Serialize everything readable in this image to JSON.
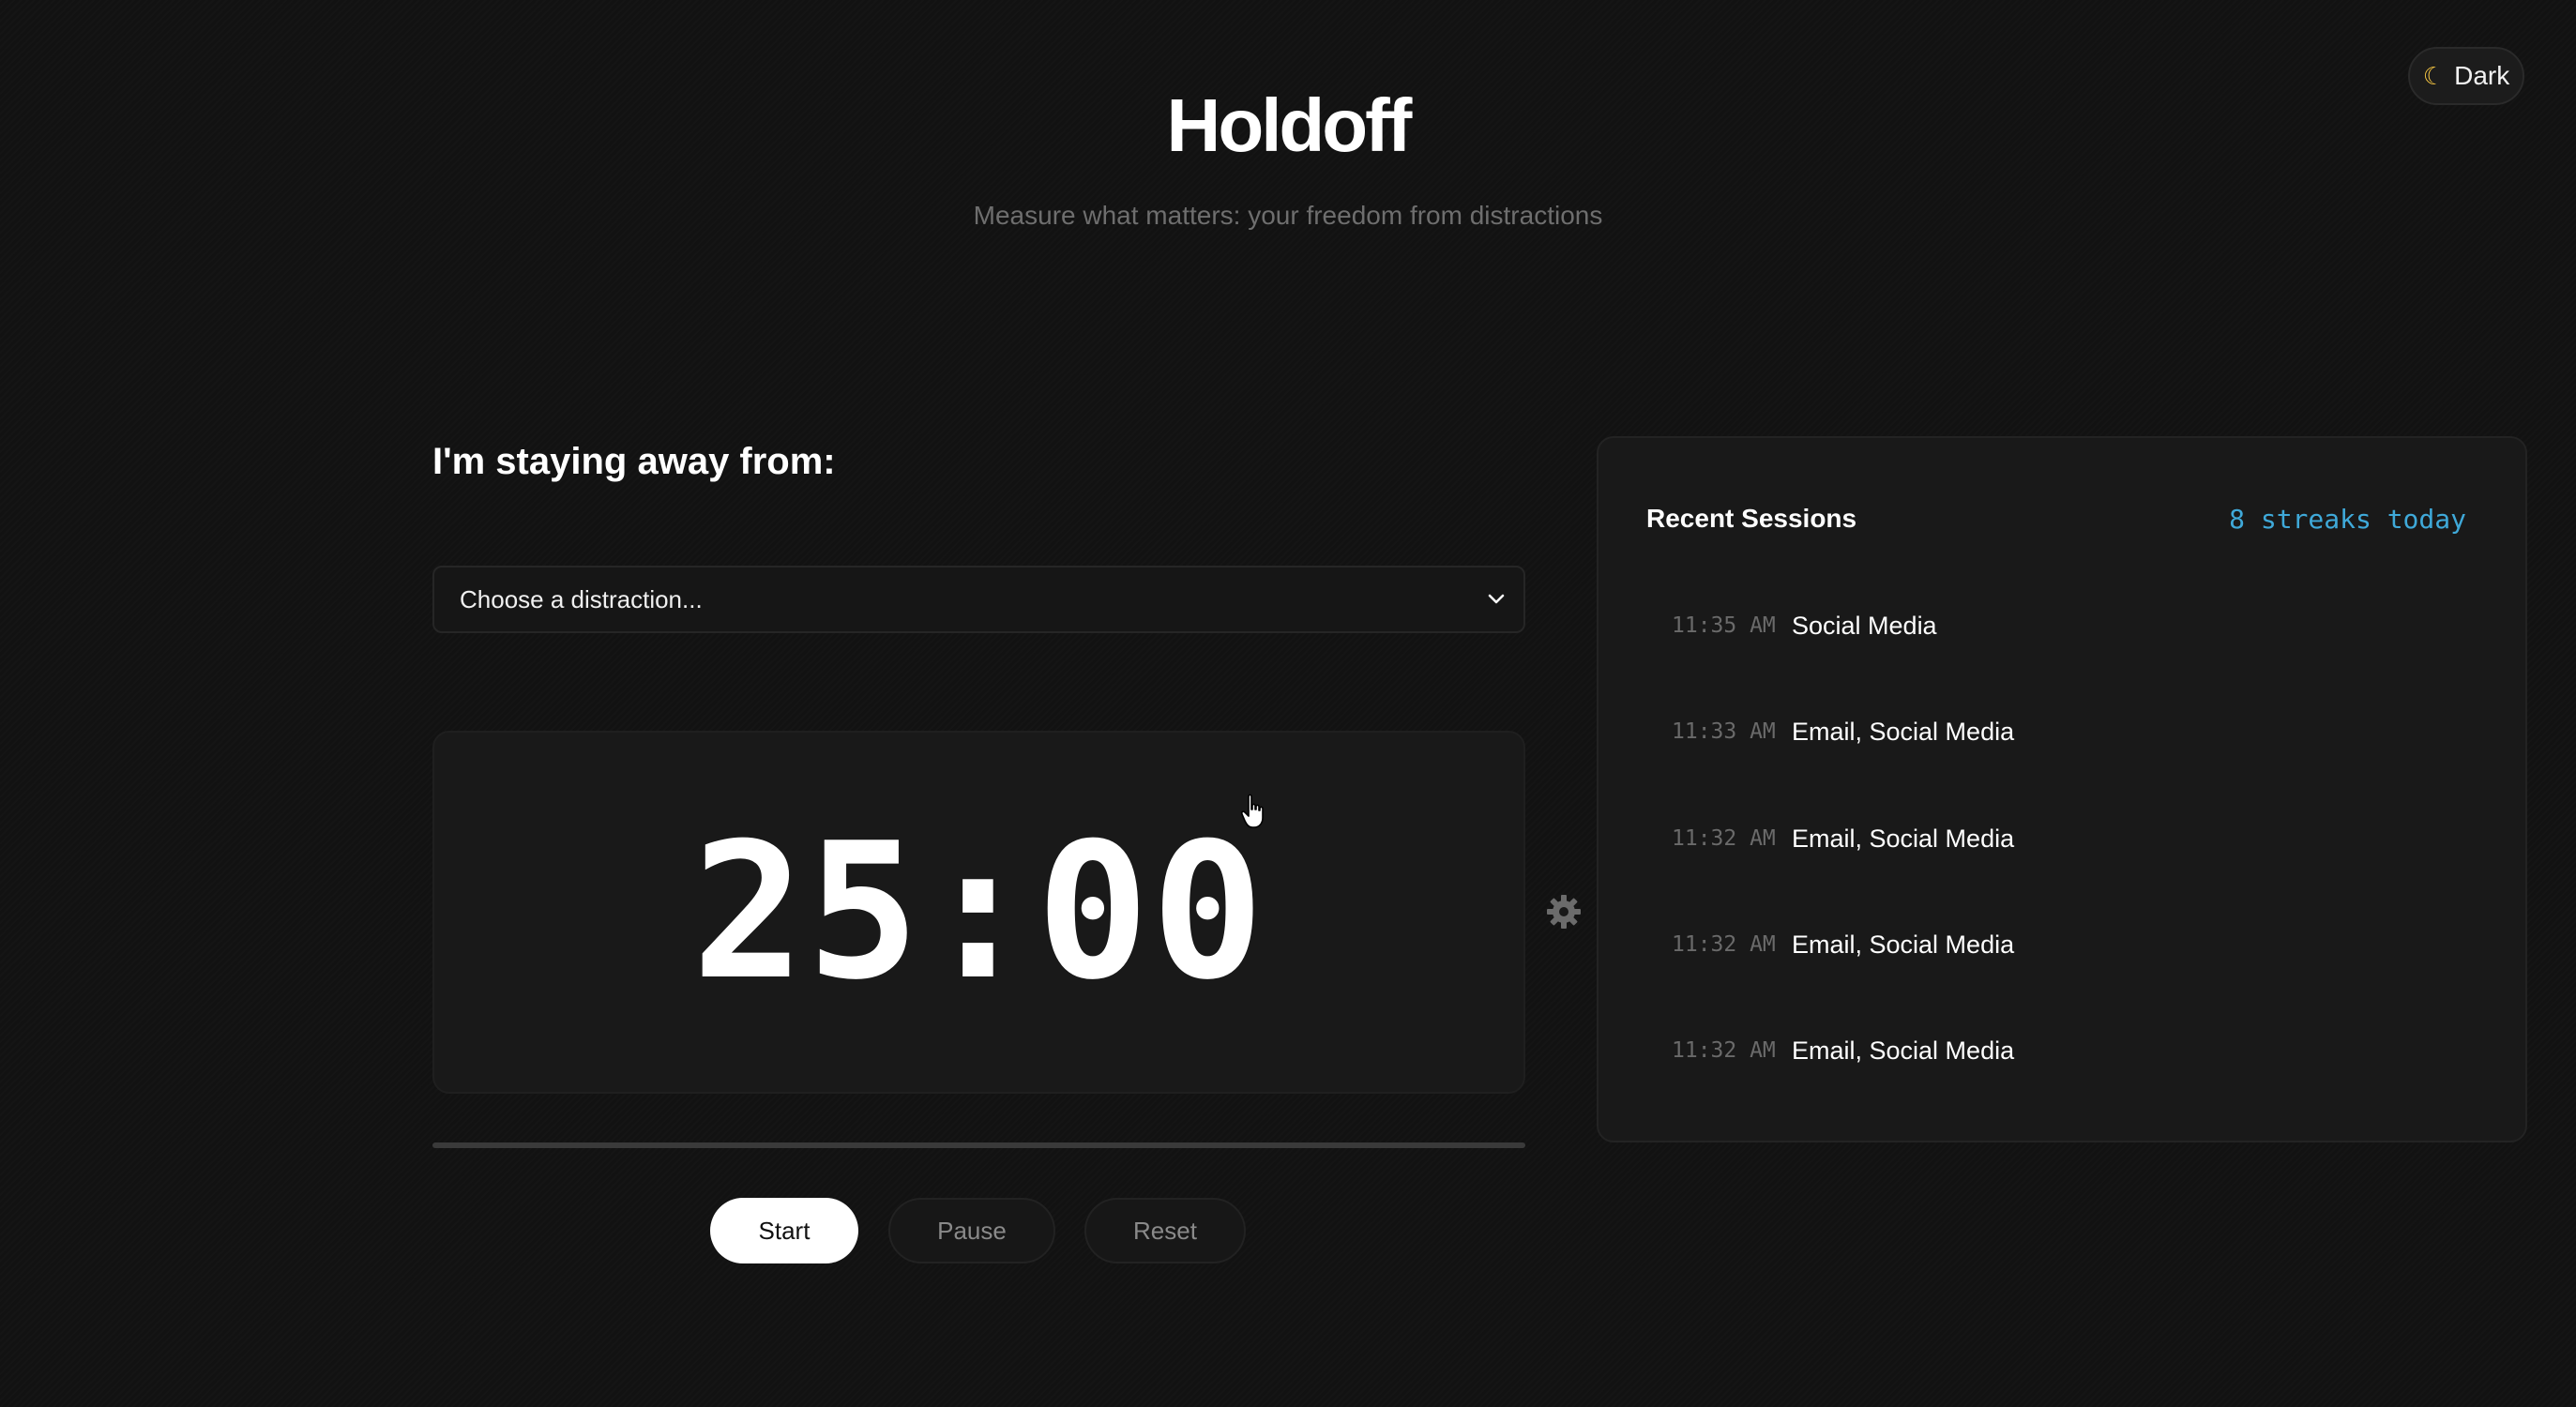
{
  "theme_toggle": {
    "icon": "moon-icon",
    "label": "Dark"
  },
  "header": {
    "title": "Holdoff",
    "subtitle": "Measure what matters: your freedom from distractions"
  },
  "distraction": {
    "label": "I'm staying away from:",
    "select_value": "Choose a distraction..."
  },
  "timer": {
    "display": "25:00",
    "progress_fraction": 0
  },
  "controls": {
    "start": "Start",
    "pause": "Pause",
    "reset": "Reset"
  },
  "settings": {
    "icon": "gear-icon"
  },
  "sessions": {
    "title": "Recent Sessions",
    "streaks": "8 streaks today",
    "items": [
      {
        "time": "11:35 AM",
        "label": "Social Media"
      },
      {
        "time": "11:33 AM",
        "label": "Email, Social Media"
      },
      {
        "time": "11:32 AM",
        "label": "Email, Social Media"
      },
      {
        "time": "11:32 AM",
        "label": "Email, Social Media"
      },
      {
        "time": "11:32 AM",
        "label": "Email, Social Media"
      }
    ]
  },
  "colors": {
    "background": "#121212",
    "card": "#191919",
    "accent_streaks": "#3fa9d9",
    "primary_button": "#ffffff"
  }
}
